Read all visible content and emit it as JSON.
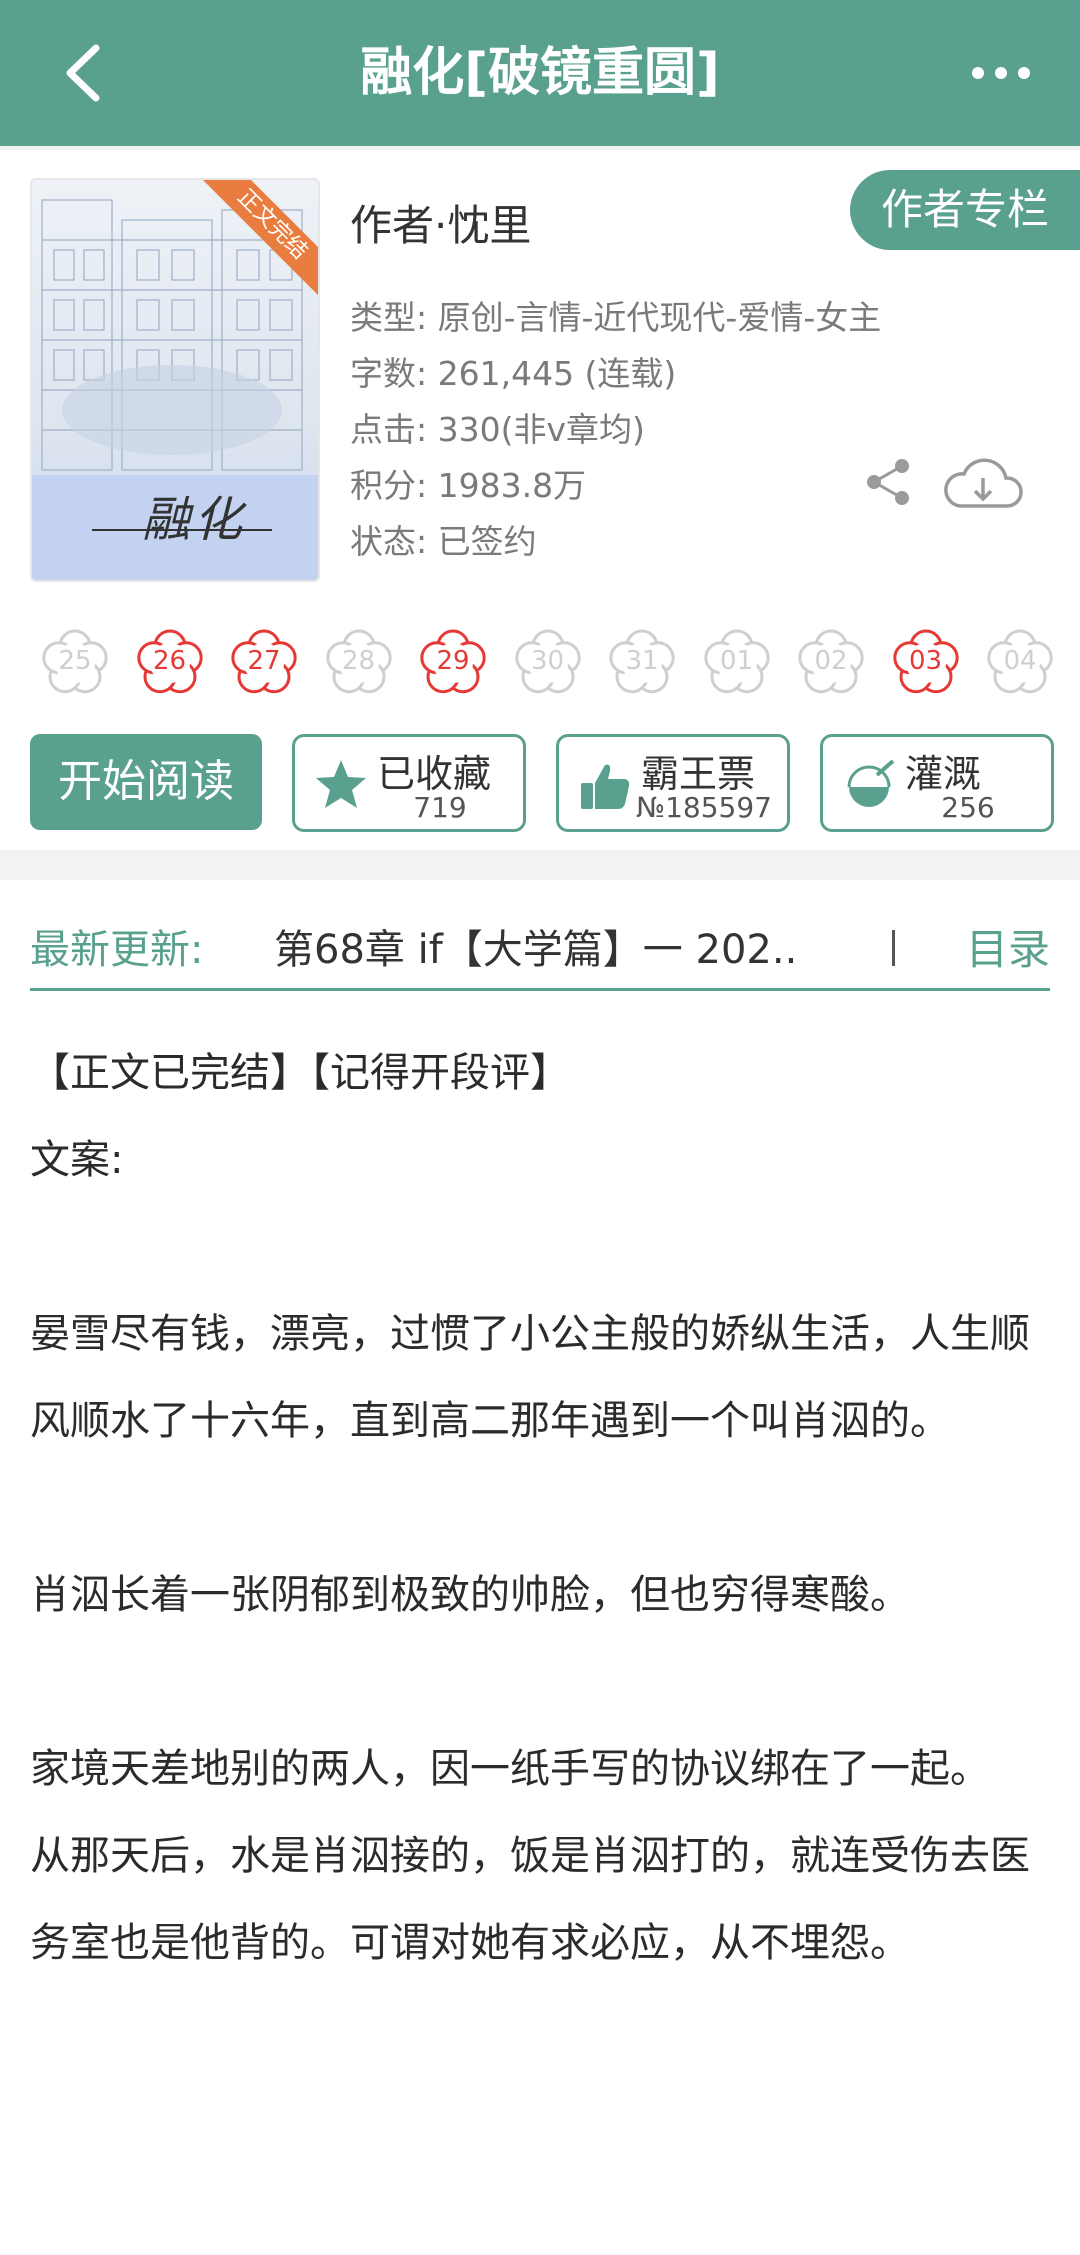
{
  "header": {
    "title": "融化[破镜重圆]"
  },
  "book": {
    "cover_ribbon": "正文完结",
    "cover_title": "融化",
    "author": "作者·忱里",
    "author_column": "作者专栏",
    "meta": [
      "类型: 原创-言情-近代现代-爱情-女主",
      "字数: 261,445 (连载)",
      "点击: 330(非v章均)",
      "积分: 1983.8万",
      "状态: 已签约"
    ]
  },
  "flowers": [
    {
      "day": "25",
      "active": false
    },
    {
      "day": "26",
      "active": true
    },
    {
      "day": "27",
      "active": true
    },
    {
      "day": "28",
      "active": false
    },
    {
      "day": "29",
      "active": true
    },
    {
      "day": "30",
      "active": false
    },
    {
      "day": "31",
      "active": false
    },
    {
      "day": "01",
      "active": false
    },
    {
      "day": "02",
      "active": false
    },
    {
      "day": "03",
      "active": true
    },
    {
      "day": "04",
      "active": false
    }
  ],
  "actions": {
    "read": "开始阅读",
    "collect": {
      "label": "已收藏",
      "count": "719"
    },
    "vote": {
      "label": "霸王票",
      "count": "№185597"
    },
    "water": {
      "label": "灌溉",
      "count": "256"
    }
  },
  "latest": {
    "label": "最新更新:",
    "chapter": "第68章  if【大学篇】一  202..",
    "toc": "目录"
  },
  "synopsis": [
    "【正文已完结】【记得开段评】",
    "文案:",
    "",
    "晏雪尽有钱，漂亮，过惯了小公主般的娇纵生活，人生顺风顺水了十六年，直到高二那年遇到一个叫肖泅的。",
    "",
    "肖泅长着一张阴郁到极致的帅脸，但也穷得寒酸。",
    "",
    "家境天差地别的两人，因一纸手写的协议绑在了一起。",
    "从那天后，水是肖泅接的，饭是肖泅打的，就连受伤去医务室也是他背的。可谓对她有求必应，从不埋怨。"
  ],
  "colors": {
    "accent": "#5aa08e",
    "flower_active": "#e53935",
    "flower_inactive": "#cfcfcf"
  }
}
